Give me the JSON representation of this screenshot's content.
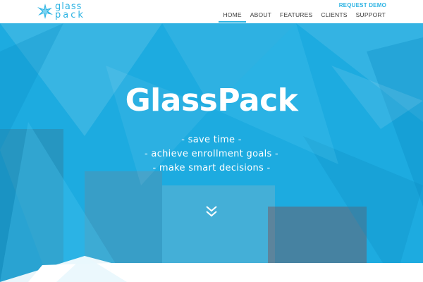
{
  "header": {
    "logo": {
      "line1": "glass",
      "line2": "pack"
    },
    "request_demo": "REQUEST DEMO",
    "nav": [
      {
        "label": "HOME",
        "active": true
      },
      {
        "label": "ABOUT"
      },
      {
        "label": "FEATURES"
      },
      {
        "label": "CLIENTS"
      },
      {
        "label": "SUPPORT"
      }
    ]
  },
  "hero": {
    "title": "GlassPack",
    "taglines": [
      "- save time -",
      "- achieve enrollment goals -",
      "- make smart decisions -"
    ],
    "scroll_icon": "double-chevron-down-icon"
  },
  "colors": {
    "accent": "#2bb3e3",
    "hero_blue": "#1fb3e8",
    "nav_text": "#3a3a3a"
  }
}
